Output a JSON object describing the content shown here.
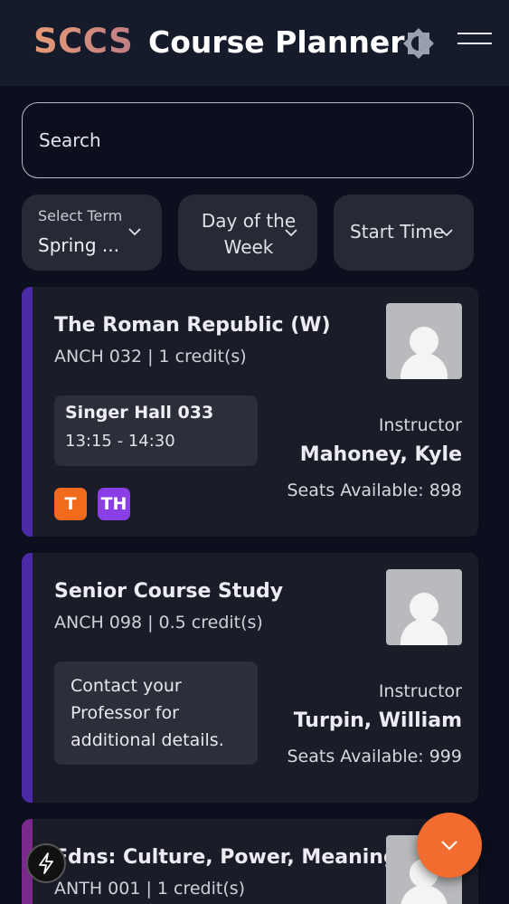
{
  "header": {
    "brand": "SCCS",
    "title": "Course Planner",
    "theme_icon": "theme-toggle-icon",
    "menu_icon": "hamburger-menu-icon"
  },
  "search": {
    "placeholder": "Search"
  },
  "filters": {
    "term_label": "Select Term",
    "term_value": "Spring ...",
    "day_label": "Day of the Week",
    "time_label": "Start Time"
  },
  "courses": [
    {
      "title": "The Roman Republic (W)",
      "code": "ANCH 032 | 1 credit(s)",
      "room": "Singer Hall 033",
      "time": "13:15 - 14:30",
      "instructor_label": "Instructor",
      "instructor": "Mahoney, Kyle",
      "seats": "Seats Available: 898",
      "days": [
        "T",
        "TH"
      ]
    },
    {
      "title": "Senior Course Study",
      "code": "ANCH 098 | 0.5 credit(s)",
      "note": "Contact your Professor for additional details.",
      "instructor_label": "Instructor",
      "instructor": "Turpin, William",
      "seats": "Seats Available: 999"
    },
    {
      "title": "Fdns: Culture, Power, Meaning",
      "code": "ANTH 001 | 1 credit(s)"
    }
  ],
  "colors": {
    "accent": "#f26b2f",
    "stripe_anch": "#4a2aa6",
    "stripe_anth": "#7a2a8c",
    "badge_t": "#f26b1d",
    "badge_th": "#8a3ee6"
  }
}
